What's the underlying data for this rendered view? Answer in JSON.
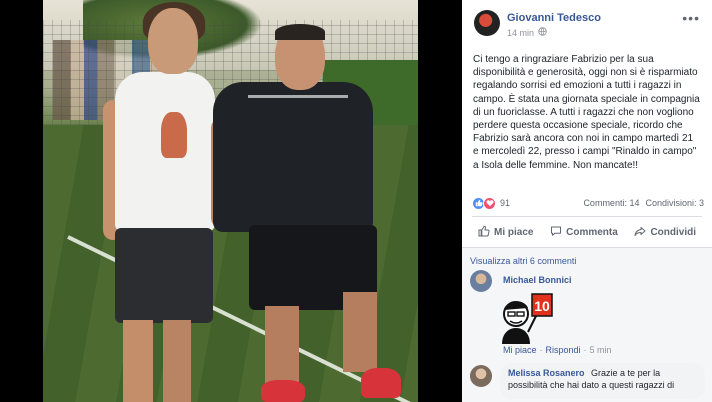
{
  "post": {
    "author": "Giovanni Tedesco",
    "time": "14 min",
    "privacy_icon": "globe-icon",
    "more_label": "•••",
    "text": "Ci tengo a ringraziare Fabrizio per la sua disponibilità e generosità, oggi non si è risparmiato regalando sorrisi ed emozioni a tutti i ragazzi in campo. È stata una giornata speciale in compagnia di un fuoriclasse. A tutti i ragazzi che non vogliono perdere questa occasione speciale, ricordo che Fabrizio sarà ancora con noi in campo martedì 21 e mercoledì 22, presso i campi \"Rinaldo in campo\" a Isola delle femmine. Non mancate!!"
  },
  "reactions": {
    "count": "91",
    "comments": "Commenti: 14",
    "shares": "Condivisioni: 3",
    "like_color": "#4f8ff7",
    "love_color": "#f0526d"
  },
  "actions": {
    "like": "Mi piace",
    "comment": "Commenta",
    "share": "Condividi"
  },
  "comments": {
    "view_more": "Visualizza altri 6 commenti",
    "items": [
      {
        "name": "Michael Bonnici",
        "sticker": "10",
        "like": "Mi piace",
        "separator": "·",
        "reply": "Rispondi",
        "time": "5 min"
      },
      {
        "name": "Melissa Rosanero",
        "text": "Grazie a te per la possibilità che hai dato a questi ragazzi di"
      }
    ]
  },
  "colors": {
    "link_blue": "#385898",
    "muted_gray": "#606770",
    "panel_bg": "#ffffff",
    "comments_bg": "#f5f6f7"
  }
}
